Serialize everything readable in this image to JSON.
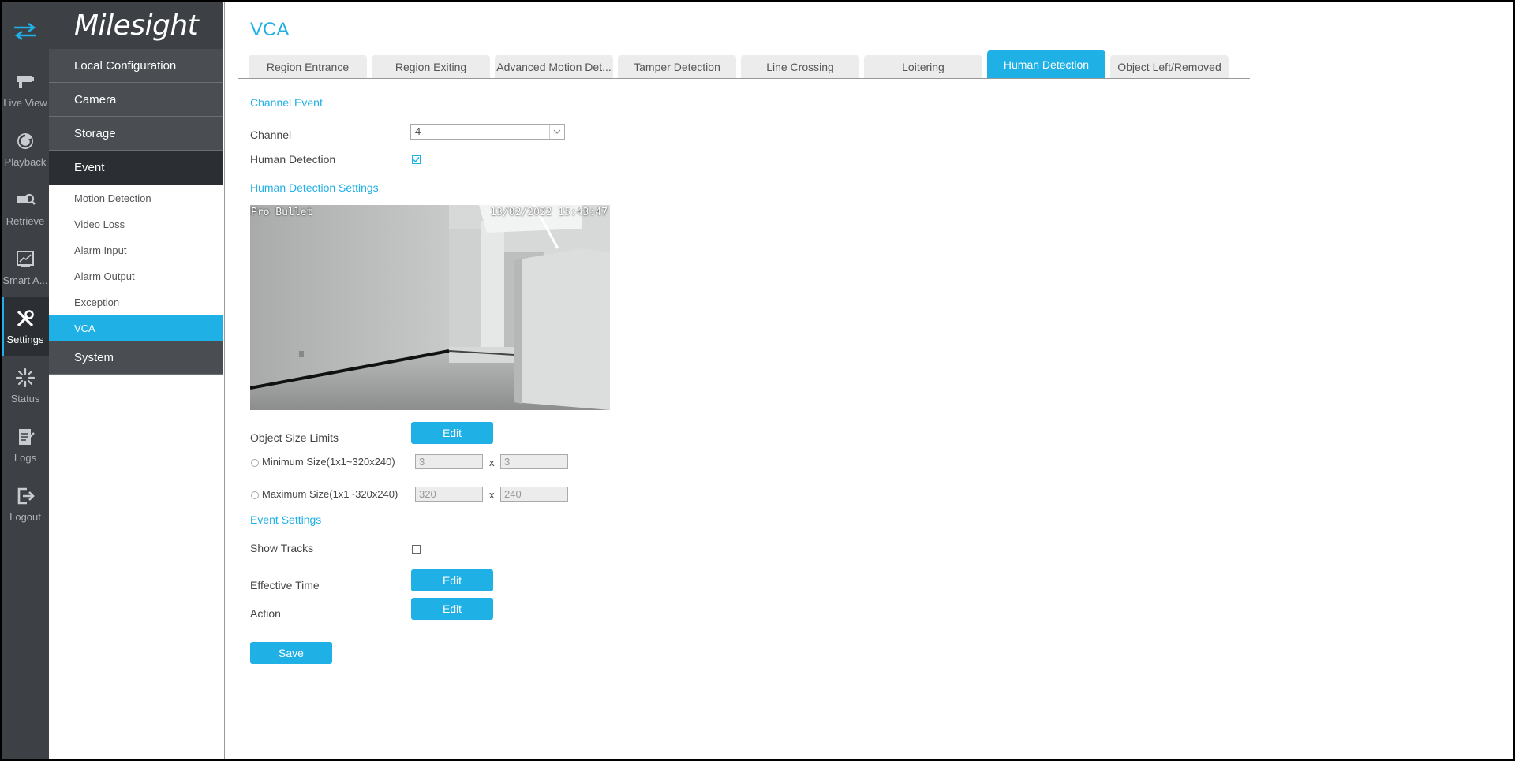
{
  "brand": "Milesight",
  "rail": [
    {
      "label": "Live View",
      "icon": "live-view-icon"
    },
    {
      "label": "Playback",
      "icon": "playback-icon"
    },
    {
      "label": "Retrieve",
      "icon": "retrieve-icon"
    },
    {
      "label": "Smart A...",
      "icon": "smart-analytics-icon"
    },
    {
      "label": "Settings",
      "icon": "settings-icon",
      "active": true
    },
    {
      "label": "Status",
      "icon": "status-icon"
    },
    {
      "label": "Logs",
      "icon": "logs-icon"
    },
    {
      "label": "Logout",
      "icon": "logout-icon"
    }
  ],
  "menu": {
    "local_configuration": "Local Configuration",
    "camera": "Camera",
    "storage": "Storage",
    "event": "Event",
    "event_items": [
      "Motion Detection",
      "Video Loss",
      "Alarm Input",
      "Alarm Output",
      "Exception",
      "VCA"
    ],
    "system": "System"
  },
  "page": {
    "title": "VCA",
    "tabs": [
      "Region Entrance",
      "Region Exiting",
      "Advanced Motion Det...",
      "Tamper Detection",
      "Line Crossing",
      "Loitering",
      "Human Detection",
      "Object Left/Removed"
    ],
    "active_tab": "Human Detection"
  },
  "channel_event": {
    "heading": "Channel Event",
    "channel_label": "Channel",
    "channel_value": "4",
    "human_detection_label": "Human Detection",
    "human_detection_checked": true
  },
  "settings": {
    "heading": "Human Detection Settings",
    "preview_name": "Pro Bullet",
    "preview_timestamp": "13/02/2022 15:43:47",
    "object_size_label": "Object Size Limits",
    "edit_label": "Edit",
    "min_label": "Minimum Size(1x1~320x240)",
    "min_w": "3",
    "min_h": "3",
    "max_label": "Maximum Size(1x1~320x240)",
    "max_w": "320",
    "max_h": "240",
    "times": "x"
  },
  "event_settings": {
    "heading": "Event Settings",
    "show_tracks_label": "Show Tracks",
    "effective_time_label": "Effective Time",
    "action_label": "Action",
    "edit_label": "Edit",
    "save_label": "Save"
  },
  "colors": {
    "accent": "#1fb0e6",
    "rail_bg": "#3d4146",
    "menu_bg": "#4a4e53",
    "menu_open": "#2b2f33"
  }
}
